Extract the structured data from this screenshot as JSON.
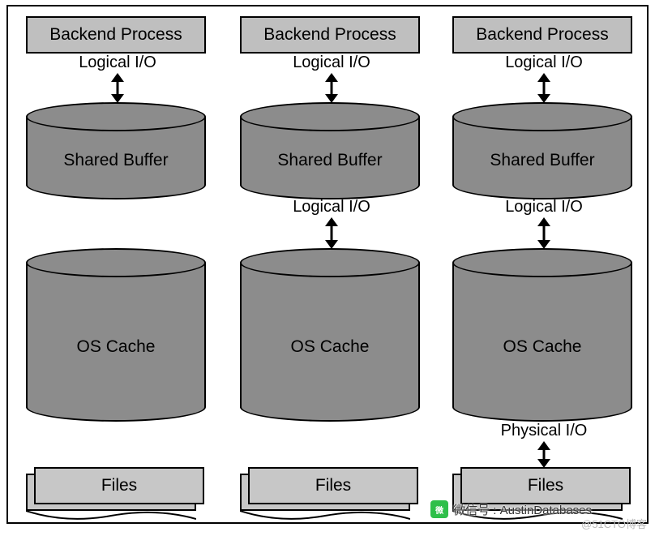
{
  "columns": [
    {
      "process": "Backend Process",
      "io1_label": "Logical I/O",
      "buffer": "Shared Buffer",
      "io2_label": null,
      "os_cache": "OS Cache",
      "io3_label": null,
      "files": "Files"
    },
    {
      "process": "Backend Process",
      "io1_label": "Logical I/O",
      "buffer": "Shared Buffer",
      "io2_label": "Logical I/O",
      "os_cache": "OS Cache",
      "io3_label": null,
      "files": "Files"
    },
    {
      "process": "Backend Process",
      "io1_label": "Logical I/O",
      "buffer": "Shared Buffer",
      "io2_label": "Logical I/O",
      "os_cache": "OS Cache",
      "io3_label": "Physical I/O",
      "files": "Files"
    }
  ],
  "overlay": {
    "wechat_label": "微信号 : AustinDatabases",
    "watermark": "@51CTO博客"
  }
}
